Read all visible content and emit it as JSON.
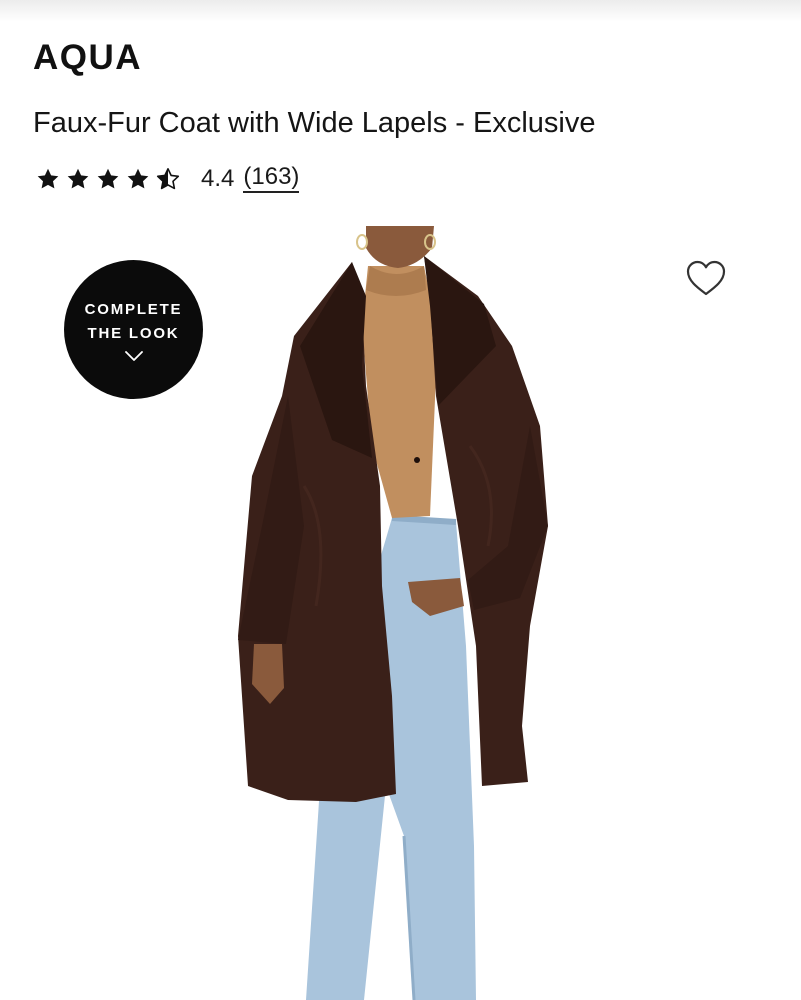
{
  "product": {
    "brand": "AQUA",
    "title": "Faux-Fur Coat with Wide Lapels - Exclusive"
  },
  "rating": {
    "value": 4.4,
    "value_text": "4.4",
    "review_count_text": "(163)",
    "stars": [
      "star-filled-icon",
      "star-filled-icon",
      "star-filled-icon",
      "star-filled-icon",
      "star-half-icon"
    ]
  },
  "complete_the_look": {
    "line1": "COMPLETE",
    "line2": "THE LOOK",
    "icon": "chevron-down-icon"
  },
  "wishlist": {
    "icon": "heart-outline-icon"
  },
  "colors": {
    "text": "#111111",
    "badge_bg": "#0b0b0b",
    "badge_text": "#ffffff",
    "coat": "#3a2019",
    "sweater": "#c18f5f",
    "jeans": "#a9c4dc"
  }
}
